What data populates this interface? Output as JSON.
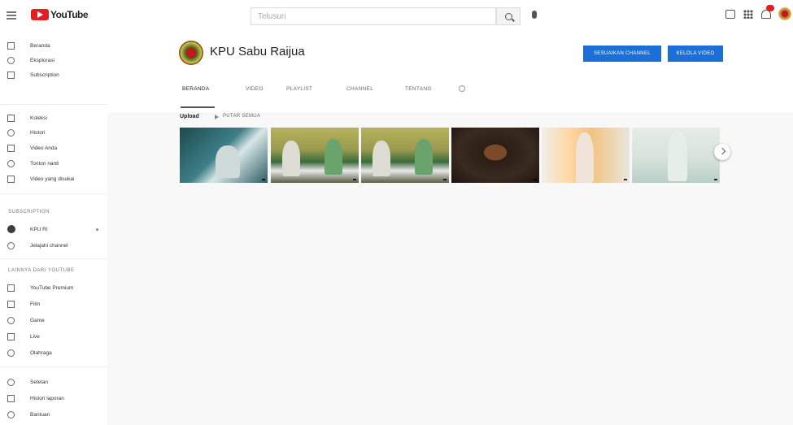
{
  "topbar": {
    "logo_text": "YouTube",
    "search_placeholder": "Telusuri"
  },
  "sidebar": {
    "main_items": [
      {
        "label": "Beranda",
        "icon": "home-icon"
      },
      {
        "label": "Eksplorasi",
        "icon": "explore-icon"
      },
      {
        "label": "Subscription",
        "icon": "subscriptions-icon"
      }
    ],
    "library_items": [
      {
        "label": "Koleksi",
        "icon": "library-icon"
      },
      {
        "label": "Histori",
        "icon": "history-icon"
      },
      {
        "label": "Video Anda",
        "icon": "your-videos-icon"
      },
      {
        "label": "Tonton nanti",
        "icon": "watch-later-icon"
      },
      {
        "label": "Video yang disukai",
        "icon": "liked-videos-icon"
      }
    ],
    "subscription_heading": "SUBSCRIPTION",
    "subscriptions": [
      {
        "label": "KPU RI",
        "icon": "channel-avatar"
      },
      {
        "label": "Jelajahi channel",
        "icon": "add-circle-icon"
      }
    ],
    "more_heading": "LAINNYA DARI YOUTUBE",
    "more_items": [
      {
        "label": "YouTube Premium",
        "icon": "youtube-premium-icon"
      },
      {
        "label": "Film",
        "icon": "film-icon"
      },
      {
        "label": "Game",
        "icon": "gaming-icon"
      },
      {
        "label": "Live",
        "icon": "live-icon"
      },
      {
        "label": "Olahraga",
        "icon": "sports-icon"
      }
    ],
    "settings_items": [
      {
        "label": "Setelan",
        "icon": "settings-icon"
      },
      {
        "label": "Histori laporan",
        "icon": "flag-icon"
      },
      {
        "label": "Bantuan",
        "icon": "help-icon"
      }
    ]
  },
  "channel": {
    "name": "KPU Sabu Raijua",
    "subscribers": "",
    "customize_button": "SESUAIKAN CHANNEL",
    "manage_button": "KELOLA VIDEO",
    "tabs": [
      "BERANDA",
      "VIDEO",
      "PLAYLIST",
      "CHANNEL",
      "TENTANG"
    ]
  },
  "uploads": {
    "title": "Upload",
    "play_all": "PUTAR SEMUA",
    "videos": [
      {
        "title": "",
        "meta": "",
        "duration": ""
      },
      {
        "title": "",
        "meta": "",
        "duration": ""
      },
      {
        "title": "",
        "meta": "",
        "duration": ""
      },
      {
        "title": "",
        "meta": "",
        "duration": ""
      },
      {
        "title": "",
        "meta": "",
        "duration": ""
      },
      {
        "title": "",
        "meta": "",
        "duration": ""
      }
    ]
  },
  "colors": {
    "accent": "#1b6fd6",
    "brand_red": "#e02020"
  }
}
